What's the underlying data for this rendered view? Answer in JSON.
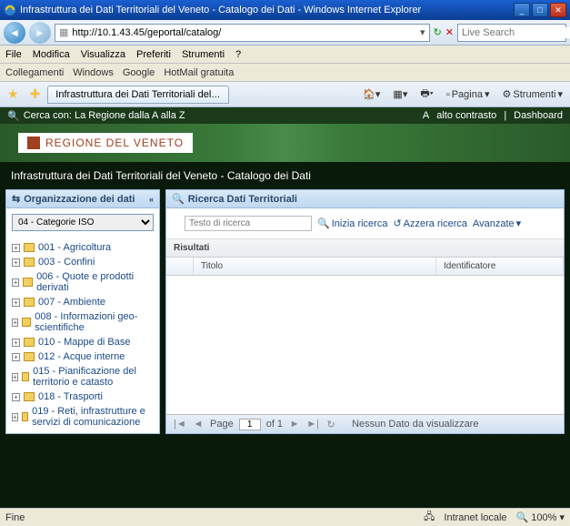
{
  "window": {
    "title": "Infrastruttura dei Dati Territoriali del Veneto - Catalogo dei Dati - Windows Internet Explorer"
  },
  "nav": {
    "url": "http://10.1.43.45/geportal/catalog/",
    "search_placeholder": "Live Search"
  },
  "menu": {
    "file": "File",
    "modifica": "Modifica",
    "visualizza": "Visualizza",
    "preferiti": "Preferiti",
    "strumenti": "Strumenti",
    "help": "?"
  },
  "links": {
    "label": "Collegamenti",
    "items": [
      "Windows",
      "Google",
      "HotMail gratuita"
    ]
  },
  "tab": {
    "label": "Infrastruttura dei Dati Territoriali del Veneto - Catalogo..."
  },
  "toolbar": {
    "pagina": "Pagina",
    "strumenti": "Strumenti"
  },
  "top": {
    "search_label": "Cerca con: La Regione dalla A alla Z",
    "contrast": "alto contrasto",
    "dashboard": "Dashboard"
  },
  "logo": {
    "text": "REGIONE DEL VENETO"
  },
  "page_title": "Infrastruttura dei Dati Territoriali del Veneto - Catalogo dei Dati",
  "left": {
    "header": "Organizzazione dei dati",
    "select": "04 - Categorie ISO",
    "tree": [
      "001 - Agricoltura",
      "003 - Confini",
      "006 - Quote e prodotti derivati",
      "007 - Ambiente",
      "008 - Informazioni geo-scientifiche",
      "010 - Mappe di Base",
      "012 - Acque interne",
      "015 - Pianificazione del territorio e catasto",
      "018 - Trasporti",
      "019 - Reti, infrastrutture e servizi di comunicazione"
    ]
  },
  "right": {
    "tab": "Ricerca Dati Territoriali",
    "search_placeholder": "Testo di ricerca",
    "search_btn": "Inizia ricerca",
    "reset_btn": "Azzera ricerca",
    "advanced": "Avanzate",
    "results_label": "Risultati",
    "col_title": "Titolo",
    "col_ident": "Identificatore"
  },
  "pager": {
    "page_label": "Page",
    "page_num": "1",
    "of": "of 1",
    "no_data": "Nessun Dato da visualizzare"
  },
  "status": {
    "left": "Fine",
    "zone": "Intranet locale",
    "zoom": "100%"
  }
}
